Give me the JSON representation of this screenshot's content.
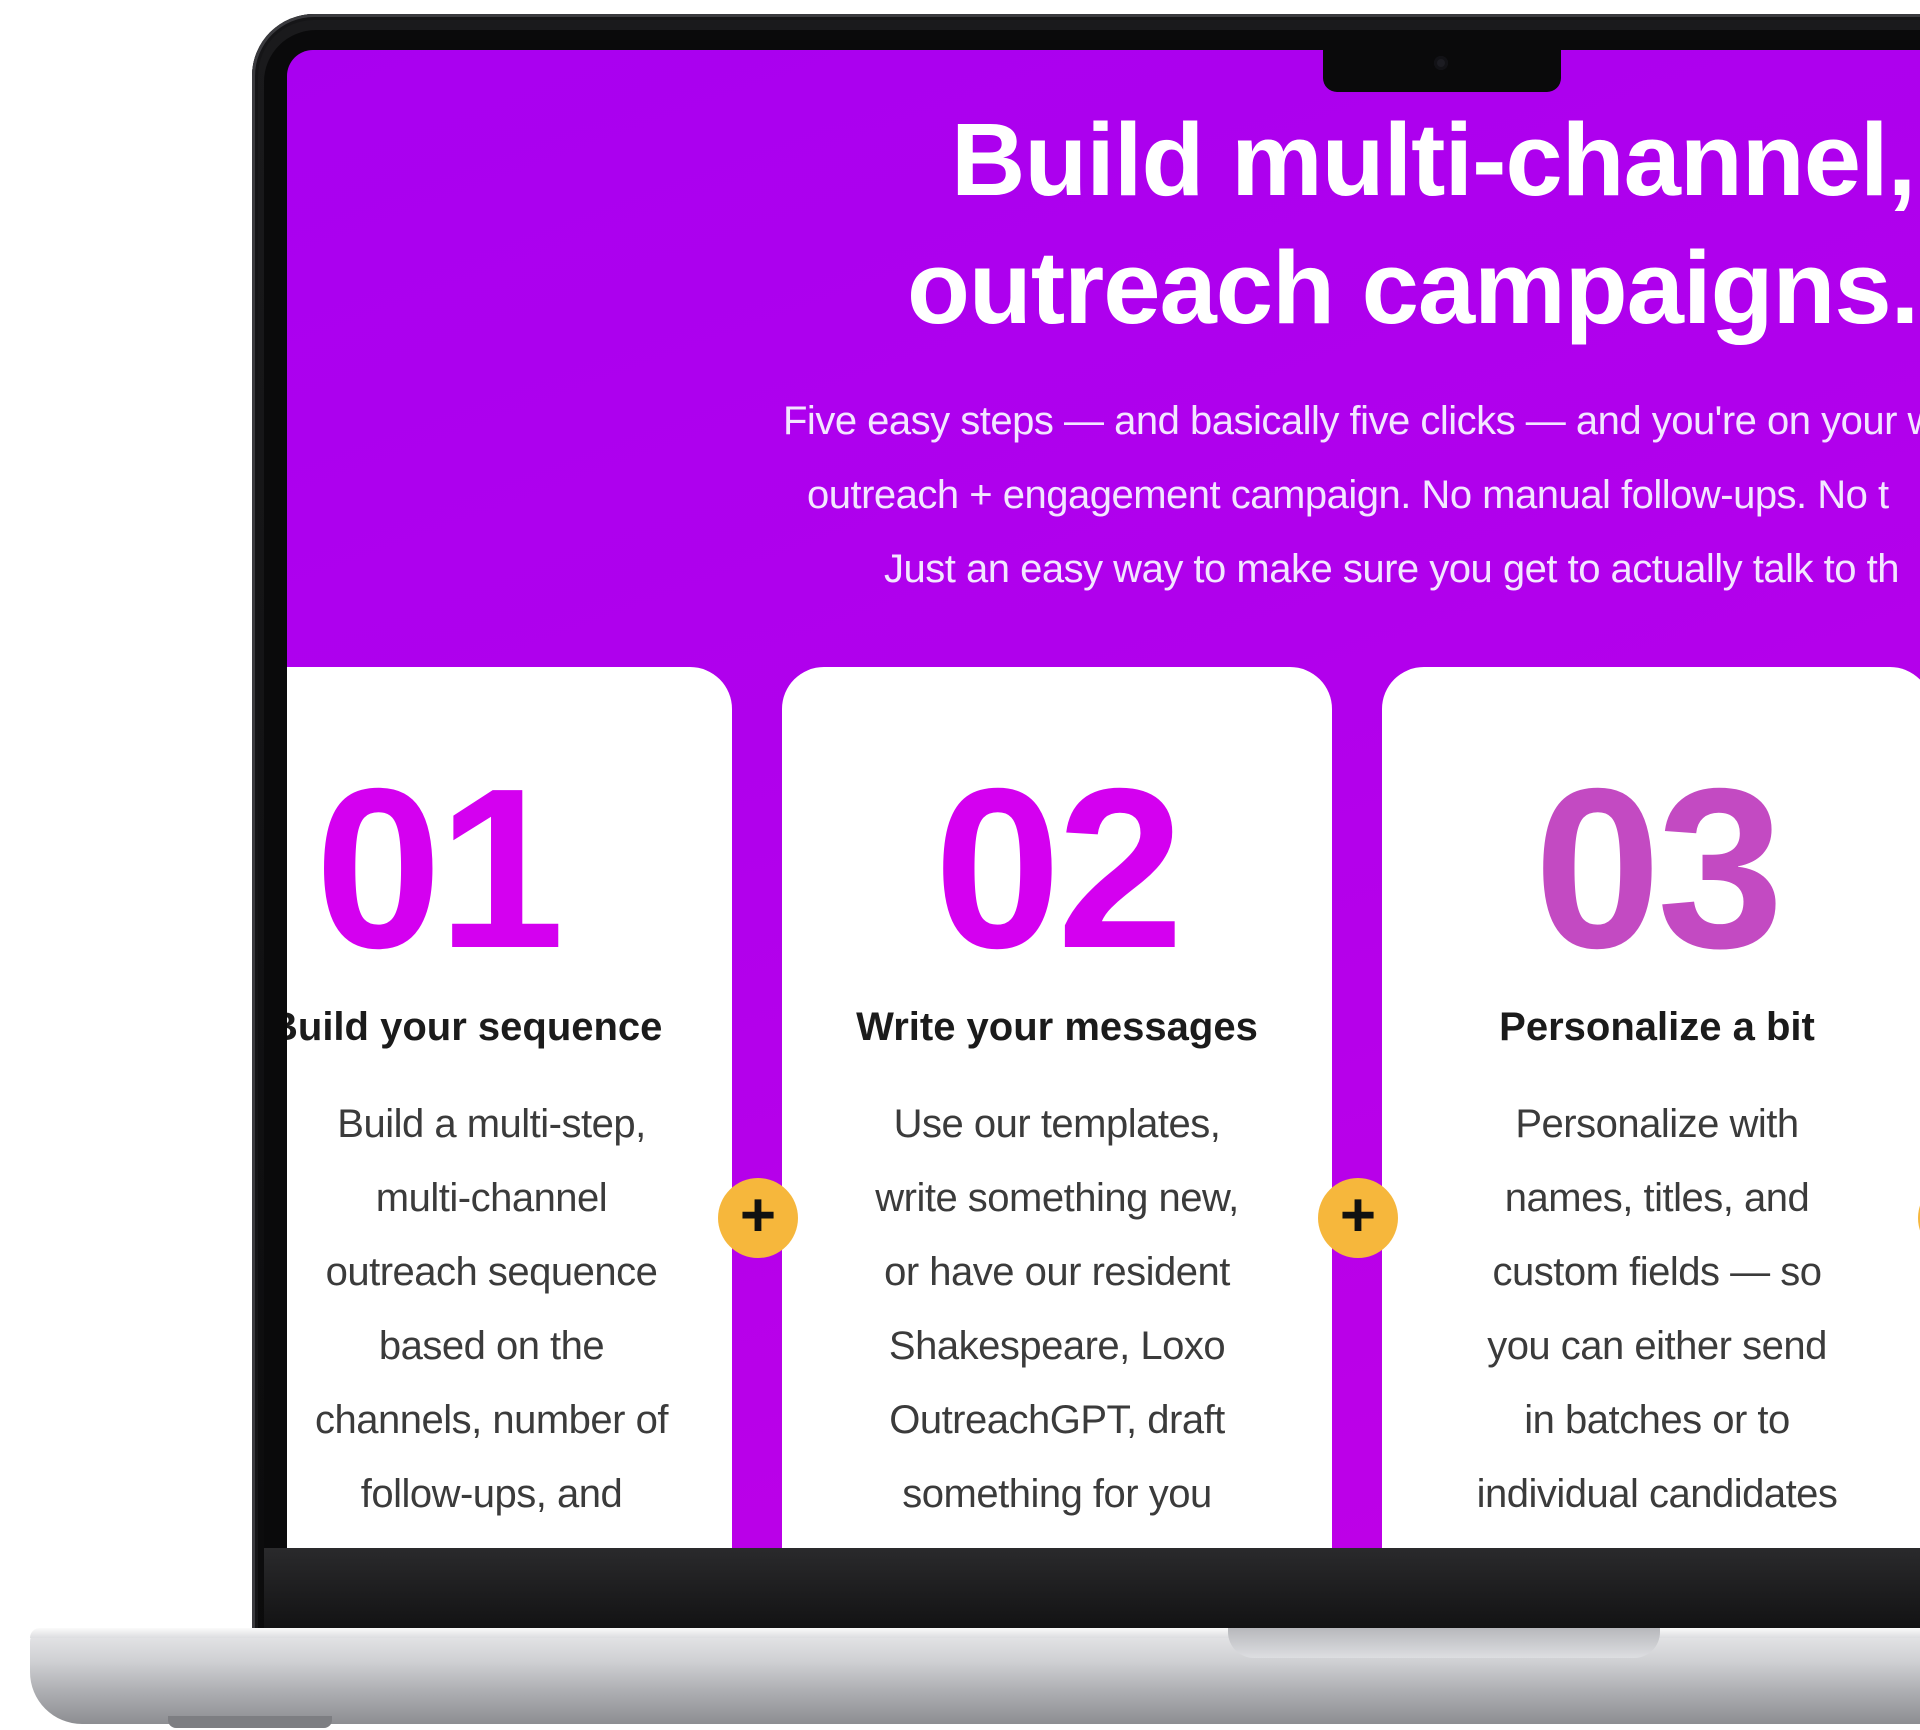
{
  "hero": {
    "title_line_1": "Build multi-channel, m",
    "title_line_2": "outreach campaigns...",
    "subtitle_line_1": "Five easy steps — and basically five clicks — and you're on your w",
    "subtitle_line_2": "outreach + engagement campaign. No manual follow-ups. No t",
    "subtitle_line_3": "Just an easy way to make sure you get to actually talk to th"
  },
  "steps": [
    {
      "number": "01",
      "title": "Build your sequence",
      "description_lines": [
        "Build a multi-step,",
        "multi-channel",
        "outreach sequence",
        "based on the",
        "channels, number of",
        "follow-ups, and"
      ]
    },
    {
      "number": "02",
      "title": "Write your messages",
      "description_lines": [
        "Use our templates,",
        "write something new,",
        "or have our resident",
        "Shakespeare, Loxo",
        "OutreachGPT, draft",
        "something for you"
      ]
    },
    {
      "number": "03",
      "title": "Personalize a bit",
      "description_lines": [
        "Personalize with",
        "names, titles, and",
        "custom fields — so",
        "you can either send",
        "in batches or to",
        "individual candidates"
      ]
    }
  ],
  "connectors": {
    "plus_symbol": "+",
    "color": "#f6b73c"
  },
  "colors": {
    "background_purple": "#b100ec",
    "step_number_magenta": "#d400f0",
    "step_number_muted": "#c34ac2",
    "card_white": "#ffffff"
  }
}
